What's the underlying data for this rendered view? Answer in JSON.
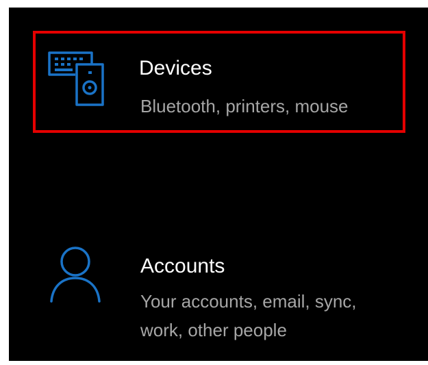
{
  "settings": {
    "items": [
      {
        "id": "devices",
        "title": "Devices",
        "description": "Bluetooth, printers, mouse",
        "icon": "devices-icon",
        "highlighted": true
      },
      {
        "id": "accounts",
        "title": "Accounts",
        "description_lines": [
          "Your accounts, email, sync,",
          "work, other people"
        ],
        "icon": "person-icon",
        "highlighted": false
      }
    ]
  },
  "colors": {
    "background": "#000000",
    "icon_accent": "#1a73c7",
    "highlight_border": "#e50000",
    "title_text": "#ffffff",
    "subtitle_text": "#a6a6a6"
  }
}
